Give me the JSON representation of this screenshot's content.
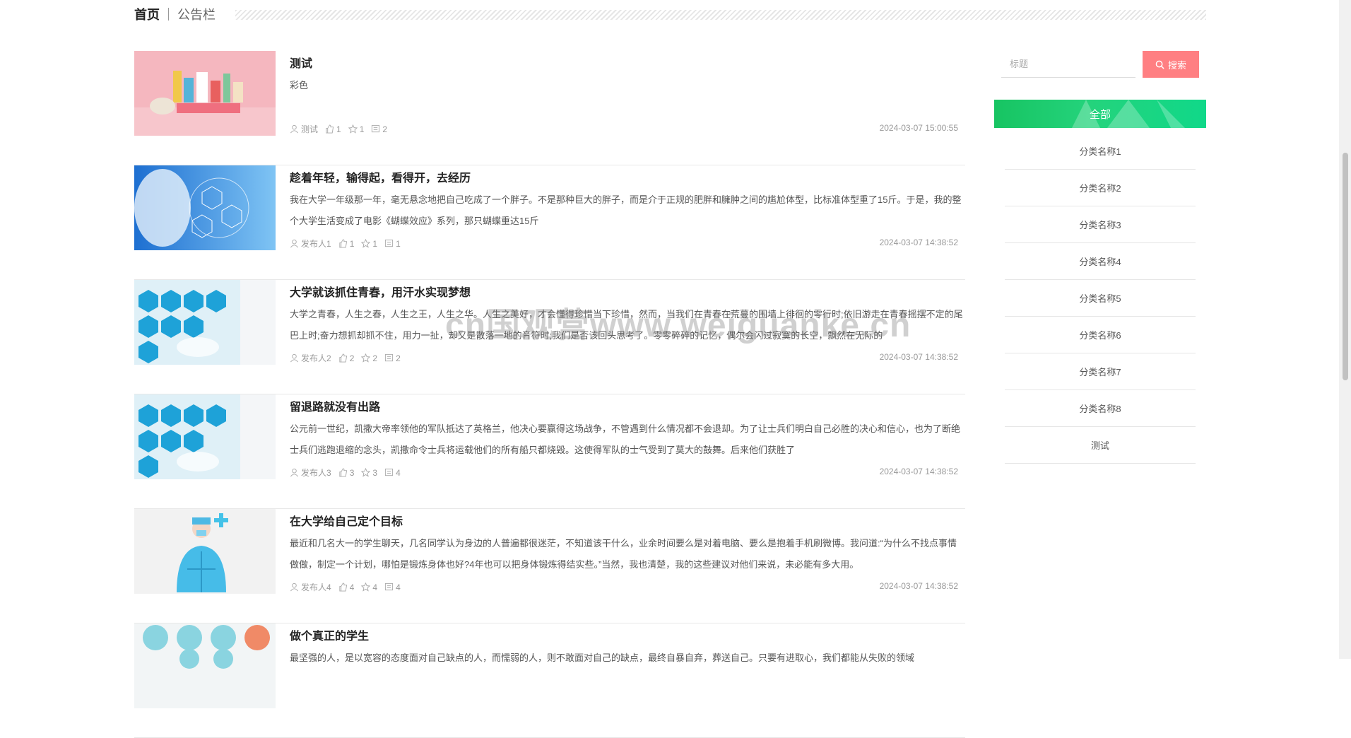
{
  "breadcrumb": {
    "home": "首页",
    "current": "公告栏"
  },
  "search": {
    "placeholder": "标题",
    "button_label": "搜索"
  },
  "categories": {
    "header": "全部",
    "items": [
      "分类名称1",
      "分类名称2",
      "分类名称3",
      "分类名称4",
      "分类名称5",
      "分类名称6",
      "分类名称7",
      "分类名称8",
      "测试"
    ]
  },
  "articles": [
    {
      "title": "测试",
      "desc": "彩色",
      "author": "测试",
      "likes": "1",
      "stars": "1",
      "comments": "2",
      "date": "2024-03-07 15:00:55",
      "thumb": "toys-pink"
    },
    {
      "title": "趁着年轻，输得起，看得开，去经历",
      "desc": "我在大学一年级那一年，毫无悬念地把自己吃成了一个胖子。不是那种巨大的胖子，而是介于正规的肥胖和臃肿之间的尴尬体型，比标准体型重了15斤。于是，我的整个大学生活变成了电影《蝴蝶效应》系列，那只蝴蝶重达15斤",
      "author": "发布人1",
      "likes": "1",
      "stars": "1",
      "comments": "1",
      "date": "2024-03-07 14:38:52",
      "thumb": "medical-microscope"
    },
    {
      "title": "大学就该抓住青春，用汗水实现梦想",
      "desc": "大学之青春，人生之春，人生之王，人生之华。人生之美好，才会懂得珍惜当下珍惜，然而，当我们在青春在荒蔓的围墙上徘徊的零行时;依旧游走在青春摇摆不定的尾巴上时;奋力想抓却抓不住，用力一扯，却又是散落一地的音符时;我们是否该回头思考了。零零碎碎的记忆，偶尔会闪过寂寞的长空，飘然在无际的",
      "author": "发布人2",
      "likes": "2",
      "stars": "2",
      "comments": "2",
      "date": "2024-03-07 14:38:52",
      "thumb": "medical-icons"
    },
    {
      "title": "留退路就没有出路",
      "desc": "公元前一世纪，凯撒大帝率领他的军队抵达了英格兰，他决心要赢得这场战争，不管遇到什么情况都不会退却。为了让士兵们明白自己必胜的决心和信心，也为了断绝士兵们逃跑退缩的念头，凯撒命令士兵将运载他们的所有船只都烧毁。这使得军队的士气受到了莫大的鼓舞。后来他们获胜了",
      "author": "发布人3",
      "likes": "3",
      "stars": "3",
      "comments": "4",
      "date": "2024-03-07 14:38:52",
      "thumb": "medical-icons"
    },
    {
      "title": "在大学给自己定个目标",
      "desc": "最近和几名大一的学生聊天，几名同学认为身边的人普遍都很迷茫，不知道该干什么，业余时间要么是对着电脑、要么是抱着手机刷微博。我问道:“为什么不找点事情做做，制定一个计划，哪怕是锻炼身体也好?4年也可以把身体锻炼得结实些。”当然，我也清楚，我的这些建议对他们来说，未必能有多大用。",
      "author": "发布人4",
      "likes": "4",
      "stars": "4",
      "comments": "4",
      "date": "2024-03-07 14:38:52",
      "thumb": "doctor"
    },
    {
      "title": "做个真正的学生",
      "desc": "最坚强的人，是以宽容的态度面对自己缺点的人，而懦弱的人，则不敢面对自己的缺点，最终自暴自弃，葬送自己。只要有进取心，我们都能从失败的领域",
      "author": "",
      "likes": "",
      "stars": "",
      "comments": "",
      "date": "",
      "thumb": "medical-circles"
    }
  ],
  "watermark": "cn国观营www.weiguanke.cn",
  "colors": {
    "search_button": "#ff7f82",
    "category_header": "#17c462"
  }
}
